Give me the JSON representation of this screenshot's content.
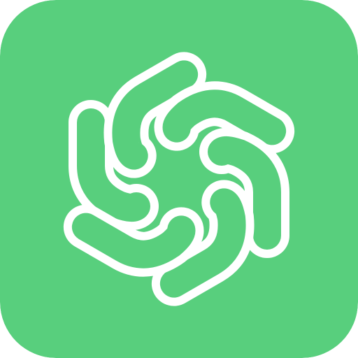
{
  "icon": {
    "name": "pinwheel-logo-icon",
    "background_color": "#58CF7D",
    "foreground_color": "#FFFFFF",
    "blade_count": 6
  }
}
